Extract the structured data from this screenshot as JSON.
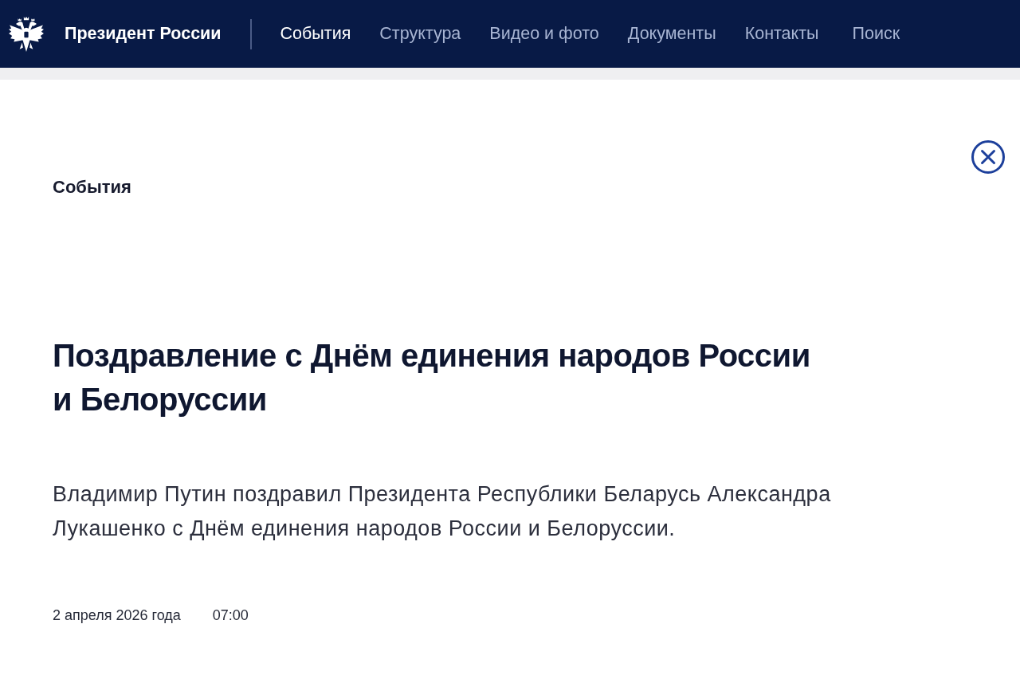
{
  "header": {
    "brand": "Президент России",
    "nav": [
      {
        "label": "События",
        "selected": true
      },
      {
        "label": "Структура",
        "selected": false
      },
      {
        "label": "Видео и фото",
        "selected": false
      },
      {
        "label": "Документы",
        "selected": false
      },
      {
        "label": "Контакты",
        "selected": false
      }
    ],
    "search_link": "Поиск"
  },
  "article": {
    "section": "События",
    "title": "Поздравление с Днём единения народов России и Белоруссии",
    "lead": "Владимир Путин поздравил Президента Республики Беларусь Александра Лукашенко с Днём единения народов России и Белоруссии.",
    "date": "2 апреля 2026 года",
    "time": "07:00"
  }
}
